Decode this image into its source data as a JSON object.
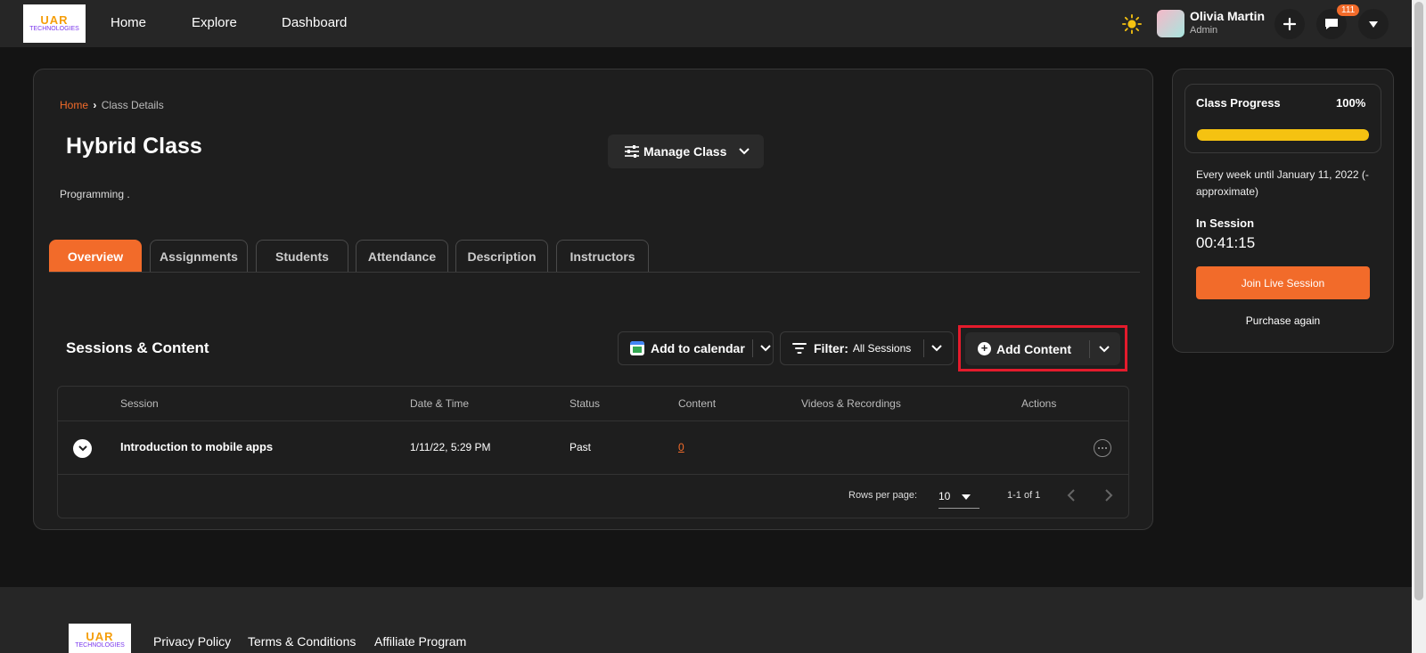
{
  "header": {
    "logo_line1": "UAR",
    "logo_line2": "TECHNOLOGIES",
    "nav": [
      "Home",
      "Explore",
      "Dashboard"
    ],
    "user_name": "Olivia Martin",
    "user_role": "Admin",
    "notification_count": "111"
  },
  "breadcrumb": {
    "home": "Home",
    "separator": "›",
    "current": "Class Details"
  },
  "class": {
    "title": "Hybrid Class",
    "category": "Programming ."
  },
  "manage_label": "Manage Class",
  "tabs": [
    "Overview",
    "Assignments",
    "Students",
    "Attendance",
    "Description",
    "Instructors"
  ],
  "active_tab": "Overview",
  "sessions": {
    "title": "Sessions & Content",
    "add_calendar": "Add to calendar",
    "filter_label": "Filter:",
    "filter_value": "All Sessions",
    "add_content": "Add Content",
    "columns": [
      "Session",
      "Date & Time",
      "Status",
      "Content",
      "Videos & Recordings",
      "Actions"
    ],
    "rows": [
      {
        "session": "Introduction to mobile apps",
        "datetime": "1/11/22, 5:29 PM",
        "status": "Past",
        "content": "0",
        "videos": ""
      }
    ],
    "rows_per_page_label": "Rows per page:",
    "rows_per_page": "10",
    "range": "1-1 of 1"
  },
  "sidebar": {
    "progress_label": "Class Progress",
    "progress_value": "100%",
    "progress_fraction": 1.0,
    "schedule": "Every week until January 11, 2022 (-approximate)",
    "in_session_label": "In Session",
    "timer": "00:41:15",
    "join_label": "Join Live Session",
    "purchase_label": "Purchase again"
  },
  "footer": {
    "links": [
      "Privacy Policy",
      "Terms & Conditions",
      "Affiliate Program"
    ]
  },
  "colors": {
    "accent": "#f26b2a",
    "progress": "#f5c211",
    "highlight": "#e41b2c"
  }
}
